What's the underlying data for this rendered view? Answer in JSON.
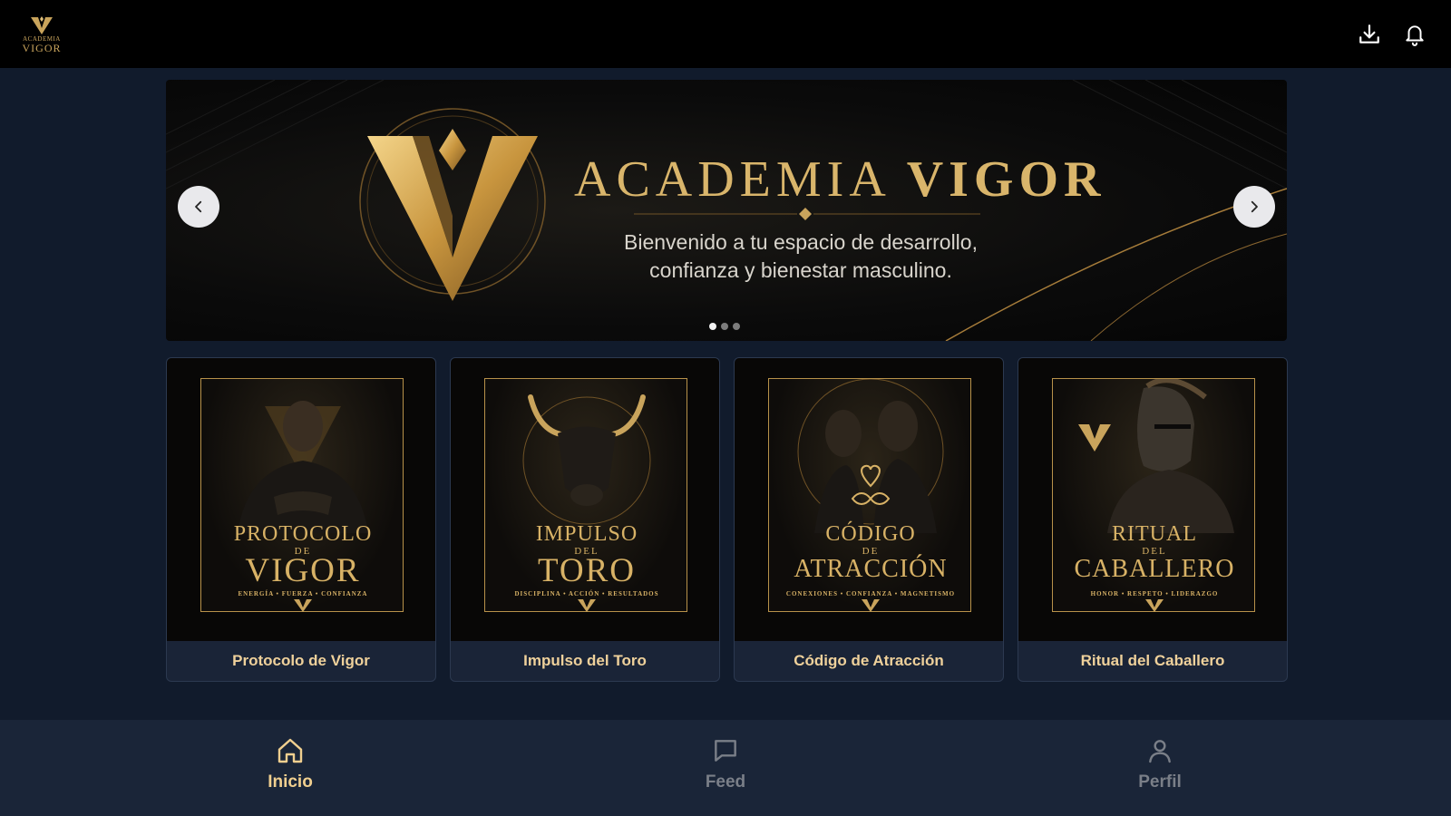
{
  "brand": {
    "logo_line1": "ACADEMIA",
    "logo_line2": "VIGOR",
    "accent_color": "#d9b56b",
    "background_color": "#111b2c"
  },
  "topbar": {
    "icons": [
      "download-icon",
      "bell-icon"
    ]
  },
  "hero": {
    "title_part1": "ACADEMIA",
    "title_part2": "VIGOR",
    "subtitle_line1": "Bienvenido a tu espacio de desarrollo,",
    "subtitle_line2": "confianza y bienestar masculino.",
    "slide_count": 3,
    "active_slide": 1
  },
  "courses": [
    {
      "label": "Protocolo de Vigor",
      "cover_title_top": "PROTOCOLO",
      "cover_title_mid": "DE",
      "cover_title_bottom": "VIGOR",
      "cover_tagline": "ENERGÍA • FUERZA • CONFIANZA"
    },
    {
      "label": "Impulso del Toro",
      "cover_title_top": "IMPULSO",
      "cover_title_mid": "DEL",
      "cover_title_bottom": "TORO",
      "cover_tagline": "DISCIPLINA • ACCIÓN • RESULTADOS"
    },
    {
      "label": "Código de Atracción",
      "cover_title_top": "CÓDIGO",
      "cover_title_mid": "DE",
      "cover_title_bottom": "ATRACCIÓN",
      "cover_tagline": "CONEXIONES • CONFIANZA • MAGNETISMO"
    },
    {
      "label": "Ritual del Caballero",
      "cover_title_top": "RITUAL",
      "cover_title_mid": "DEL",
      "cover_title_bottom": "CABALLERO",
      "cover_tagline": "HONOR • RESPETO • LIDERAZGO"
    }
  ],
  "bottom_nav": {
    "items": [
      {
        "label": "Inicio",
        "icon": "home-icon",
        "active": true
      },
      {
        "label": "Feed",
        "icon": "chat-icon",
        "active": false
      },
      {
        "label": "Perfil",
        "icon": "user-icon",
        "active": false
      }
    ]
  }
}
